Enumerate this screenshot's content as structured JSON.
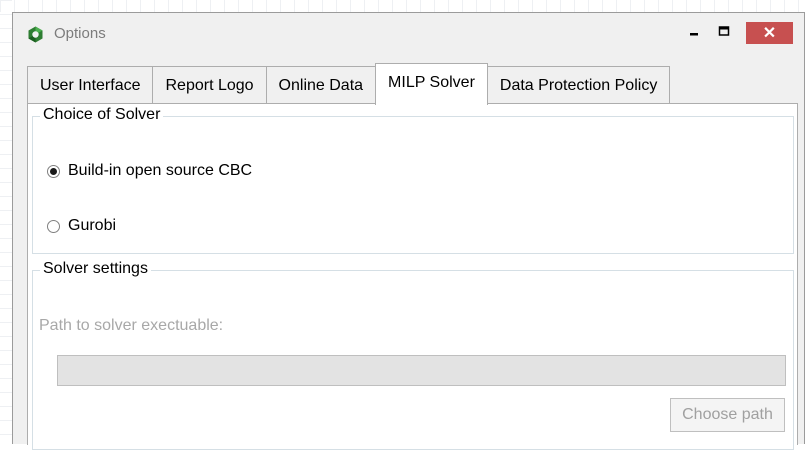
{
  "window": {
    "title": "Options",
    "close_glyph": "✕"
  },
  "tabs": [
    {
      "label": "User Interface",
      "active": false
    },
    {
      "label": "Report Logo",
      "active": false
    },
    {
      "label": "Online Data",
      "active": false
    },
    {
      "label": "MILP Solver",
      "active": true
    },
    {
      "label": "Data Protection Policy",
      "active": false
    }
  ],
  "solver_choice": {
    "title": "Choice of Solver",
    "options": [
      {
        "label": "Build-in open source CBC",
        "selected": true
      },
      {
        "label": "Gurobi",
        "selected": false
      }
    ]
  },
  "solver_settings": {
    "title": "Solver settings",
    "path_label": "Path to solver exectuable:",
    "path_value": "",
    "choose_button": "Choose path",
    "enabled": false
  },
  "colors": {
    "close_button": "#c75050",
    "app_icon_green": "#2e7d32",
    "disabled_text": "#a8a8a8",
    "groupbox_border": "#d5dfe5"
  },
  "icons": {
    "app": "app-logo-icon",
    "minimize": "minimize-icon",
    "maximize": "maximize-icon",
    "close": "close-icon"
  }
}
